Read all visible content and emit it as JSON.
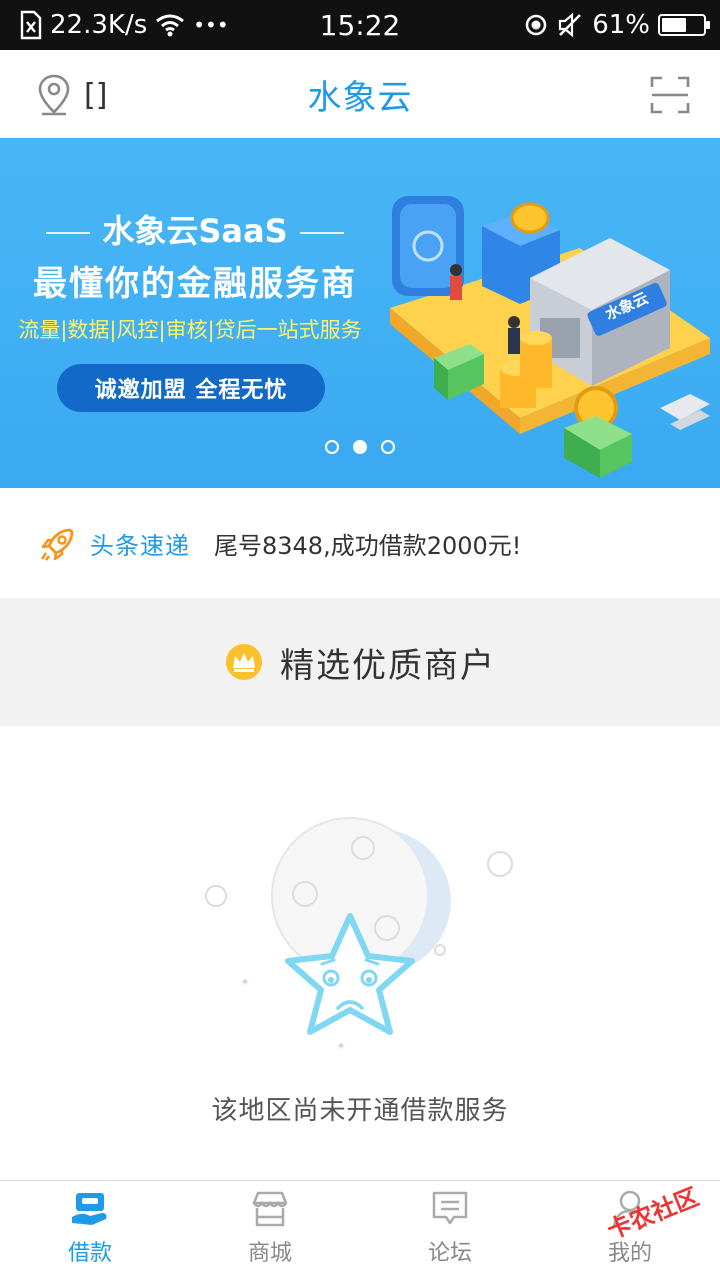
{
  "status_bar": {
    "net_speed": "22.3K/s",
    "more": "•••",
    "time": "15:22",
    "battery": "61%",
    "battery_level": 0.61
  },
  "header": {
    "title": "水象云",
    "city": "[]"
  },
  "banner": {
    "headline": "水象云SaaS",
    "subtitle": "最懂你的金融服务商",
    "features": "流量|数据|风控|审核|贷后一站式服务",
    "cta": "诚邀加盟  全程无忧",
    "building_sign": "水象云",
    "pages": 3,
    "current_page": 2
  },
  "news": {
    "label": "头条速递",
    "text": "尾号8348,成功借款2000元!"
  },
  "section": {
    "title": "精选优质商户"
  },
  "empty_state": {
    "message": "该地区尚未开通借款服务"
  },
  "tabs": [
    {
      "label": "借款",
      "icon": "loan-icon",
      "active": true
    },
    {
      "label": "商城",
      "icon": "store-icon",
      "active": false
    },
    {
      "label": "论坛",
      "icon": "forum-icon",
      "active": false
    },
    {
      "label": "我的",
      "icon": "profile-icon",
      "active": false
    }
  ],
  "watermark": "卡农社区",
  "colors": {
    "accent": "#1e9be8",
    "banner": "#3aa9f2",
    "cta": "#1269c7",
    "feature_text": "#fff36b"
  }
}
